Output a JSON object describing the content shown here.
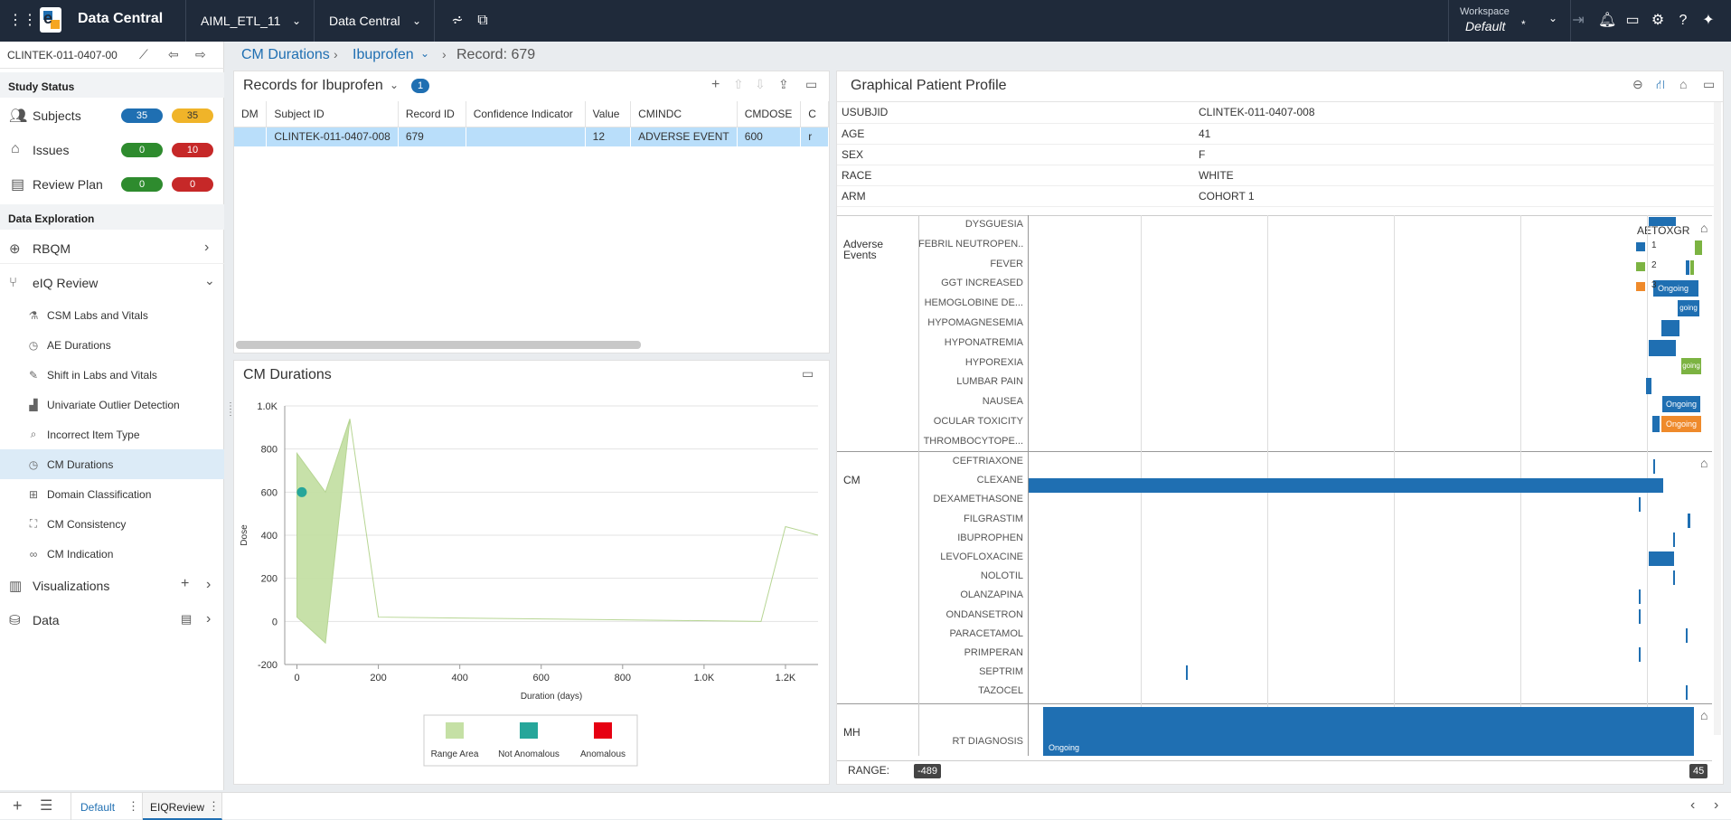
{
  "topbar": {
    "app_title": "Data Central",
    "project": "AIML_ETL_11",
    "module": "Data Central",
    "workspace_label": "Workspace",
    "workspace_value": "Default",
    "workspace_marker": "*"
  },
  "breadcrumb": {
    "items": [
      "CM Durations",
      "Ibuprofen"
    ],
    "record": "Record: 679"
  },
  "sidebar": {
    "study_id": "CLINTEK-011-0407-00",
    "study_status_title": "Study Status",
    "status_rows": [
      {
        "label": "Subjects",
        "a": "35",
        "b": "35"
      },
      {
        "label": "Issues",
        "a": "0",
        "b": "10"
      },
      {
        "label": "Review Plan",
        "a": "0",
        "b": "0"
      }
    ],
    "data_exploration_title": "Data Exploration",
    "rbqm": "RBQM",
    "eiq_review": "eIQ Review",
    "eiq_items": [
      "CSM Labs and Vitals",
      "AE Durations",
      "Shift in Labs and Vitals",
      "Univariate Outlier Detection",
      "Incorrect Item Type",
      "CM Durations",
      "Domain Classification",
      "CM Consistency",
      "CM Indication"
    ],
    "visualizations": "Visualizations",
    "data": "Data"
  },
  "records": {
    "title": "Records for Ibuprofen",
    "count": "1",
    "columns": [
      "DM",
      "Subject ID",
      "Record ID",
      "Confidence Indicator",
      "Value",
      "CMINDC",
      "CMDOSE",
      "C"
    ],
    "rows": [
      [
        "",
        "CLINTEK-011-0407-008",
        "679",
        "",
        "12",
        "ADVERSE EVENT",
        "600",
        "r"
      ]
    ]
  },
  "cm_chart_panel": {
    "title": "CM Durations"
  },
  "chart_data": {
    "type": "area",
    "title": "",
    "xlabel": "Duration (days)",
    "ylabel": "Dose",
    "xlim": [
      -30,
      1280
    ],
    "ylim": [
      -200,
      1000
    ],
    "x_ticks": [
      "0",
      "200",
      "400",
      "600",
      "800",
      "1.0K",
      "1.2K"
    ],
    "x_tick_values": [
      0,
      200,
      400,
      600,
      800,
      1000,
      1200
    ],
    "y_ticks": [
      "1.0K",
      "800",
      "600",
      "400",
      "200",
      "0",
      "-200"
    ],
    "y_tick_values": [
      1000,
      800,
      600,
      400,
      200,
      0,
      -200
    ],
    "range_area": {
      "x": [
        0,
        70,
        130,
        200,
        1140,
        1200,
        1280
      ],
      "upper": [
        780,
        600,
        940,
        20,
        0,
        440,
        400
      ],
      "lower": [
        20,
        -100,
        940,
        20,
        0,
        440,
        400
      ]
    },
    "points": [
      {
        "x": 12,
        "y": 600,
        "class": "Not Anomalous"
      }
    ],
    "legend": [
      {
        "name": "Range Area",
        "color": "#c5e0a5"
      },
      {
        "name": "Not Anomalous",
        "color": "#26a69a"
      },
      {
        "name": "Anomalous",
        "color": "#e60012"
      }
    ]
  },
  "profile": {
    "title": "Graphical Patient Profile",
    "demographics": [
      {
        "key": "USUBJID",
        "value": "CLINTEK-011-0407-008"
      },
      {
        "key": "AGE",
        "value": "41"
      },
      {
        "key": "SEX",
        "value": "F"
      },
      {
        "key": "RACE",
        "value": "WHITE"
      },
      {
        "key": "ARM",
        "value": "COHORT 1"
      }
    ],
    "ae_section": "Adverse Events",
    "ae_labels": [
      "DYSGUESIA",
      "FEBRIL NEUTROPEN...",
      "FEVER",
      "GGT INCREASED",
      "HEMOGLOBINE DE...",
      "HYPOMAGNESEMIA",
      "HYPONATREMIA",
      "HYPOREXIA",
      "LUMBAR PAIN",
      "NAUSEA",
      "OCULAR TOXICITY",
      "THROMBOCYTOPE..."
    ],
    "aetox_title": "AETOXGR",
    "aetox_legend": [
      {
        "label": "1",
        "color": "#1f6fb2"
      },
      {
        "label": "2",
        "color": "#7cb342"
      },
      {
        "label": "3",
        "color": "#ef8a2b"
      }
    ],
    "cm_section": "CM",
    "cm_labels": [
      "CEFTRIAXONE",
      "CLEXANE",
      "DEXAMETHASONE",
      "FILGRASTIM",
      "IBUPROPHEN",
      "LEVOFLOXACINE",
      "NOLOTIL",
      "OLANZAPINA",
      "ONDANSETRON",
      "PARACETAMOL",
      "PRIMPERAN",
      "SEPTRIM",
      "TAZOCEL"
    ],
    "mh_section": "MH",
    "mh_labels": [
      "RT DIAGNOSIS"
    ],
    "ongoing": "Ongoing",
    "ongoing_short": "going",
    "range_label": "RANGE:",
    "range_min": "-489",
    "range_max": "45"
  },
  "bottombar": {
    "tabs": [
      "Default",
      "EIQReview"
    ]
  },
  "colors": {
    "topbar": "#1f2a3a",
    "accent": "#1f6fb2",
    "selected_row": "#b9defa",
    "active_nav": "#dcebf7"
  }
}
